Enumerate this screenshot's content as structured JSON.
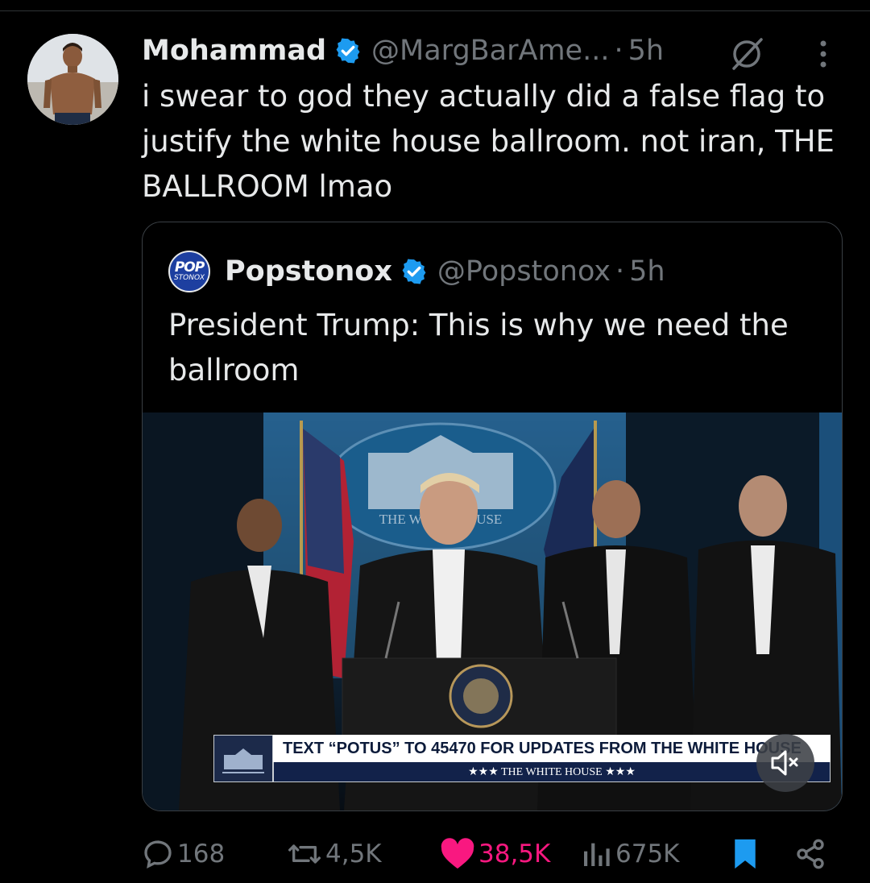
{
  "tweet": {
    "author_name": "Mohammad",
    "author_handle": "@MargBarAme...",
    "separator": "·",
    "time": "5h",
    "text": "i swear to god they actually did a false flag to justify the white house ballroom. not iran, THE BALLROOM lmao"
  },
  "quoted_tweet": {
    "logo_line1": "POP",
    "logo_line2": "STONOX",
    "author_name": "Popstonox",
    "author_handle": "@Popstonox",
    "separator": "·",
    "time": "5h",
    "text": "President Trump: This is why we need the ballroom",
    "media": {
      "backdrop_text": "THE WHITE HOUSE",
      "lower_third_main": "TEXT “POTUS” TO 45470 FOR UPDATES FROM THE WHITE HOUSE",
      "lower_third_sub": "★★★   THE WHITE HOUSE   ★★★"
    }
  },
  "actions": {
    "replies": "168",
    "reposts": "4,5K",
    "likes": "38,5K",
    "views": "675K"
  },
  "colors": {
    "background": "#000000",
    "primary_text": "#e7e9ea",
    "secondary_text": "#71767b",
    "verified_blue": "#1d9bf0",
    "like_pink": "#f91880"
  }
}
